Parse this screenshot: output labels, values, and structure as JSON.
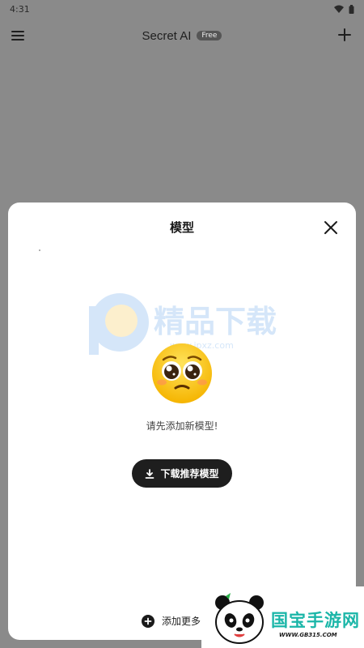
{
  "status_bar": {
    "time": "4:31",
    "wifi_icon": "wifi-icon",
    "battery_icon": "battery-icon"
  },
  "app_bar": {
    "menu_icon": "hamburger-menu-icon",
    "title": "Secret AI",
    "badge": "Free",
    "add_icon": "plus-icon"
  },
  "sheet": {
    "title": "模型",
    "close_icon": "close-icon",
    "watermark_text": "精品下载",
    "watermark_url": "www.jpxz.com",
    "emoji_icon": "pleading-face-emoji",
    "empty_message": "请先添加新模型!",
    "download_button": {
      "icon": "download-icon",
      "label": "下载推荐模型"
    },
    "add_more": {
      "icon": "add-circle-icon",
      "label": "添加更多"
    }
  },
  "logo_overlay": {
    "brand": "国宝手游网",
    "url": "WWW.GB315.COM"
  },
  "colors": {
    "scrim": "#8a8a8a",
    "sheet_bg": "#ffffff",
    "button_bg": "#1e1e1e",
    "brand_teal": "#1bb6a8"
  }
}
